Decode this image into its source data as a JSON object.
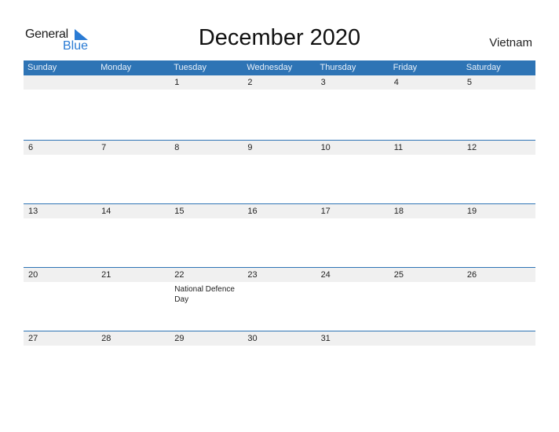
{
  "logo": {
    "part1": "General",
    "part2": "Blue",
    "icon": "triangle-flag-icon"
  },
  "title": "December 2020",
  "country": "Vietnam",
  "colors": {
    "header": "#2e74b5",
    "date_band": "#f0f0f0",
    "logo_blue": "#2a7bd4"
  },
  "weekdays": [
    "Sunday",
    "Monday",
    "Tuesday",
    "Wednesday",
    "Thursday",
    "Friday",
    "Saturday"
  ],
  "weeks": [
    [
      "",
      "",
      "1",
      "2",
      "3",
      "4",
      "5"
    ],
    [
      "6",
      "7",
      "8",
      "9",
      "10",
      "11",
      "12"
    ],
    [
      "13",
      "14",
      "15",
      "16",
      "17",
      "18",
      "19"
    ],
    [
      "20",
      "21",
      "22",
      "23",
      "24",
      "25",
      "26"
    ],
    [
      "27",
      "28",
      "29",
      "30",
      "31",
      "",
      ""
    ]
  ],
  "holidays": [
    {
      "week": 3,
      "day": 2,
      "date": "22",
      "name": "National Defence Day"
    }
  ]
}
